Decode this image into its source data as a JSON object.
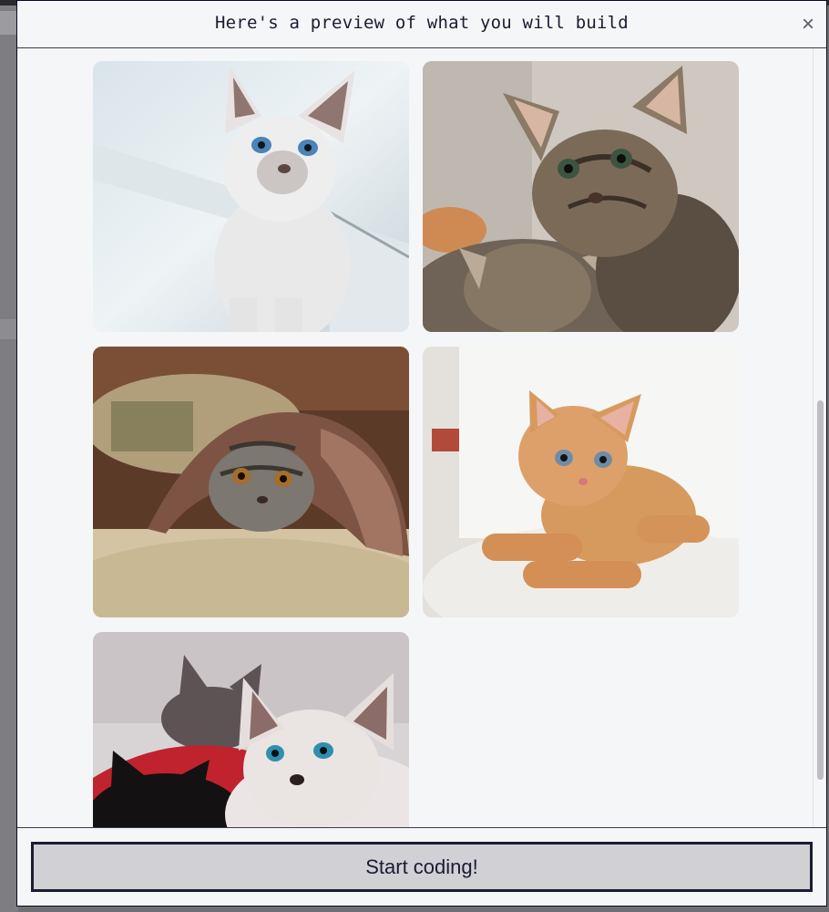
{
  "modal": {
    "title": "Here's a preview of what you will build",
    "close_icon": "close-icon",
    "close_glyph": "×"
  },
  "gallery": {
    "photos": [
      {
        "subject": "white-siamese-kitten-by-window"
      },
      {
        "subject": "two-tabby-kittens"
      },
      {
        "subject": "grey-tabby-kitten-under-blanket"
      },
      {
        "subject": "orange-kitten-lying-on-white"
      },
      {
        "subject": "white-kitten-with-black-kitten"
      }
    ]
  },
  "footer": {
    "start_label": "Start coding!"
  }
}
